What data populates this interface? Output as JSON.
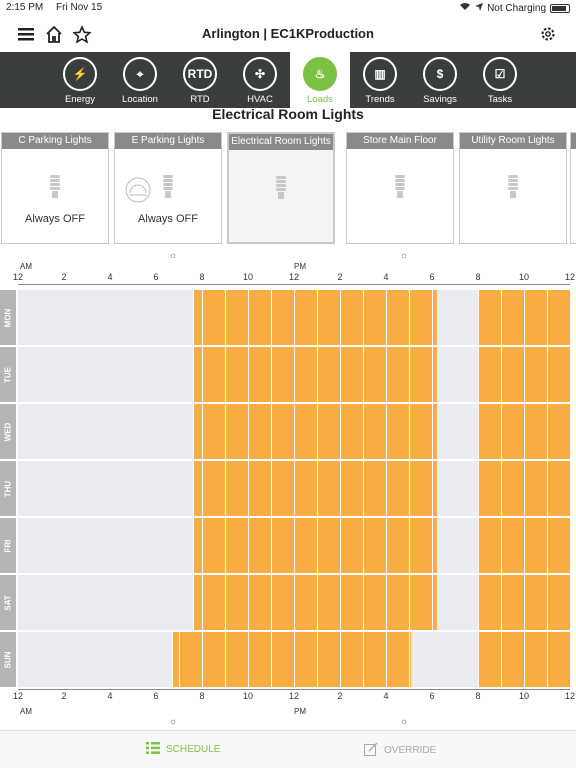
{
  "status": {
    "time": "2:15 PM",
    "date": "Fri Nov 15",
    "charging": "Not Charging"
  },
  "header": {
    "title": "Arlington | EC1KProduction"
  },
  "nav": [
    {
      "label": "Energy",
      "icon": "bolt-icon",
      "glyph": "⚡"
    },
    {
      "label": "Location",
      "icon": "location-pin-icon",
      "glyph": "⌖"
    },
    {
      "label": "RTD",
      "icon": "rtd-icon",
      "glyph": "RTD"
    },
    {
      "label": "HVAC",
      "icon": "fan-icon",
      "glyph": "✣"
    },
    {
      "label": "Loads",
      "icon": "bulb-icon",
      "glyph": "♨"
    },
    {
      "label": "Trends",
      "icon": "chart-icon",
      "glyph": "▥"
    },
    {
      "label": "Savings",
      "icon": "dollar-icon",
      "glyph": "$"
    },
    {
      "label": "Tasks",
      "icon": "checklist-icon",
      "glyph": "☑"
    }
  ],
  "active_nav": "Loads",
  "page": {
    "title": "Electrical Room Lights"
  },
  "loads": [
    {
      "name": "C Parking Lights",
      "status": "Always OFF",
      "sun": false
    },
    {
      "name": "E Parking Lights",
      "status": "Always OFF",
      "sun": true
    },
    {
      "name": "Electrical Room Lights",
      "status": "",
      "sun": false
    },
    {
      "name": "Store Main Floor",
      "status": "",
      "sun": false
    },
    {
      "name": "Utility Room Lights",
      "status": "",
      "sun": false
    }
  ],
  "axis": {
    "ticks": [
      "12",
      "2",
      "4",
      "6",
      "8",
      "10",
      "12",
      "2",
      "4",
      "6",
      "8",
      "10",
      "12"
    ],
    "am": "AM",
    "pm": "PM"
  },
  "schedule": [
    {
      "day": "MON",
      "on": [
        [
          7.6,
          18.2
        ],
        [
          20.0,
          24.0
        ]
      ]
    },
    {
      "day": "TUE",
      "on": [
        [
          7.6,
          18.2
        ],
        [
          20.0,
          24.0
        ]
      ]
    },
    {
      "day": "WED",
      "on": [
        [
          7.6,
          18.2
        ],
        [
          20.0,
          24.0
        ]
      ]
    },
    {
      "day": "THU",
      "on": [
        [
          7.6,
          18.2
        ],
        [
          20.0,
          24.0
        ]
      ]
    },
    {
      "day": "FRI",
      "on": [
        [
          7.6,
          18.2
        ],
        [
          20.0,
          24.0
        ]
      ]
    },
    {
      "day": "SAT",
      "on": [
        [
          7.6,
          18.2
        ],
        [
          20.0,
          24.0
        ]
      ]
    },
    {
      "day": "SUN",
      "on": [
        [
          6.7,
          17.1
        ],
        [
          20.0,
          24.0
        ]
      ]
    }
  ],
  "colors": {
    "on": "#f8ad42",
    "off": "#ecebef",
    "accent": "#7cc242",
    "nav_bg": "#3a3d3e"
  },
  "tabs": {
    "schedule": "SCHEDULE",
    "override": "OVERRIDE"
  }
}
